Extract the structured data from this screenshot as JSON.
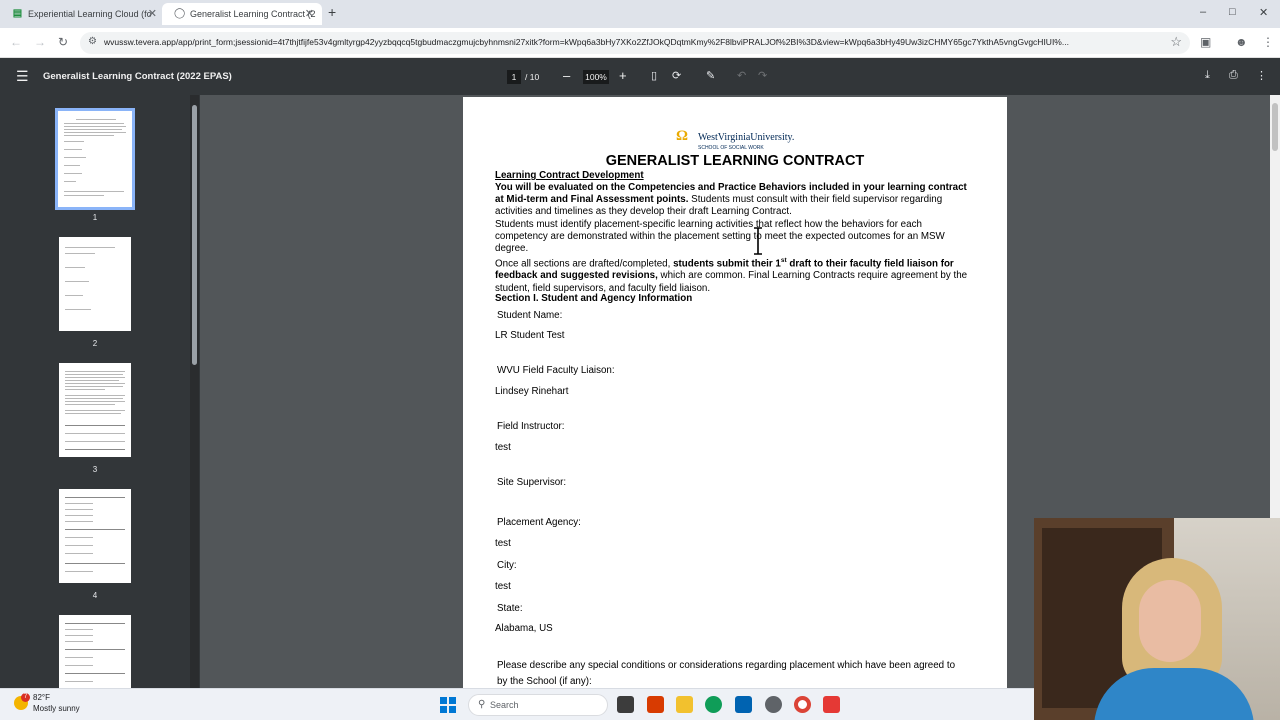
{
  "browser": {
    "tabs": [
      {
        "label": "Experiential Learning Cloud (fo",
        "active": false,
        "favicon_color": "#1e8e3e"
      },
      {
        "label": "Generalist Learning Contract (2",
        "active": true,
        "favicon_color": "#5f6368"
      }
    ],
    "new_tab": "+",
    "window_controls": {
      "minimize": "–",
      "maximize": "□",
      "close": "✕"
    },
    "url": "wvussw.tevera.app/app/print_form;jsessionid=4t7thjtfijfe53v4gmltyrgp42yyzbqqcq5tgbudmaczgmujcbyhnmsni27xitk?form=kWpq6a3bHy7XKo2ZfJOkQDqtmKmy%2F8lbviPRALJOf%2BI%3D&view=kWpq6a3bHy49Uw3izCHMY65gc7YkthA5vngGvgcHIUI%..."
  },
  "pdf_toolbar": {
    "title": "Generalist Learning Contract (2022 EPAS)",
    "current_page": "1",
    "total_pages": "/ 10",
    "zoom": "100%",
    "zoom_out": "–",
    "zoom_in": "+"
  },
  "thumbnails": [
    {
      "label": "1"
    },
    {
      "label": "2"
    },
    {
      "label": "3"
    },
    {
      "label": "4"
    }
  ],
  "document": {
    "logo": {
      "main": "WestVirginiaUniversity.",
      "sub": "SCHOOL OF SOCIAL WORK"
    },
    "title": "GENERALIST LEARNING CONTRACT",
    "section_dev_heading": "Learning Contract Development",
    "p1_bold": "You will be evaluated on the Competencies and Practice Behaviors included in your learning contract at Mid-term and Final Assessment points.",
    "p1_rest": " Students must consult with their field supervisor regarding activities and timelines as they develop their draft Learning Contract.",
    "p2": "Students must identify placement-specific learning activities that reflect how the behaviors for each competency are demonstrated within the placement setting to meet the expected outcomes for an MSW degree.",
    "p3_start": "Once all sections are drafted/completed, ",
    "p3_bold1": "students submit their 1",
    "p3_sup": "st",
    "p3_bold2": " draft to their faculty field liaison for feedback and suggested revisions,",
    "p3_rest": " which are common. Final Learning Contracts require agreement by the student, field supervisors, and faculty field liaison.",
    "section1_heading": "Section I. Student and Agency Information",
    "fields": {
      "student_name_label": "Student Name:",
      "student_name_value": "LR Student Test",
      "liaison_label": "WVU Field Faculty Liaison:",
      "liaison_value": "Lindsey Rinehart",
      "instructor_label": "Field Instructor:",
      "instructor_value": "test",
      "site_supervisor_label": "Site Supervisor:",
      "agency_label": "Placement Agency:",
      "agency_value": "test",
      "city_label": "City:",
      "city_value": "test",
      "state_label": "State:",
      "state_value": "Alabama, US",
      "conditions_label": "Please describe any special conditions or considerations regarding placement which have been agreed to by the School (if any):"
    }
  },
  "taskbar": {
    "weather_temp": "82°F",
    "weather_cond": "Mostly sunny",
    "weather_badge": "7",
    "search_placeholder": "Search"
  }
}
